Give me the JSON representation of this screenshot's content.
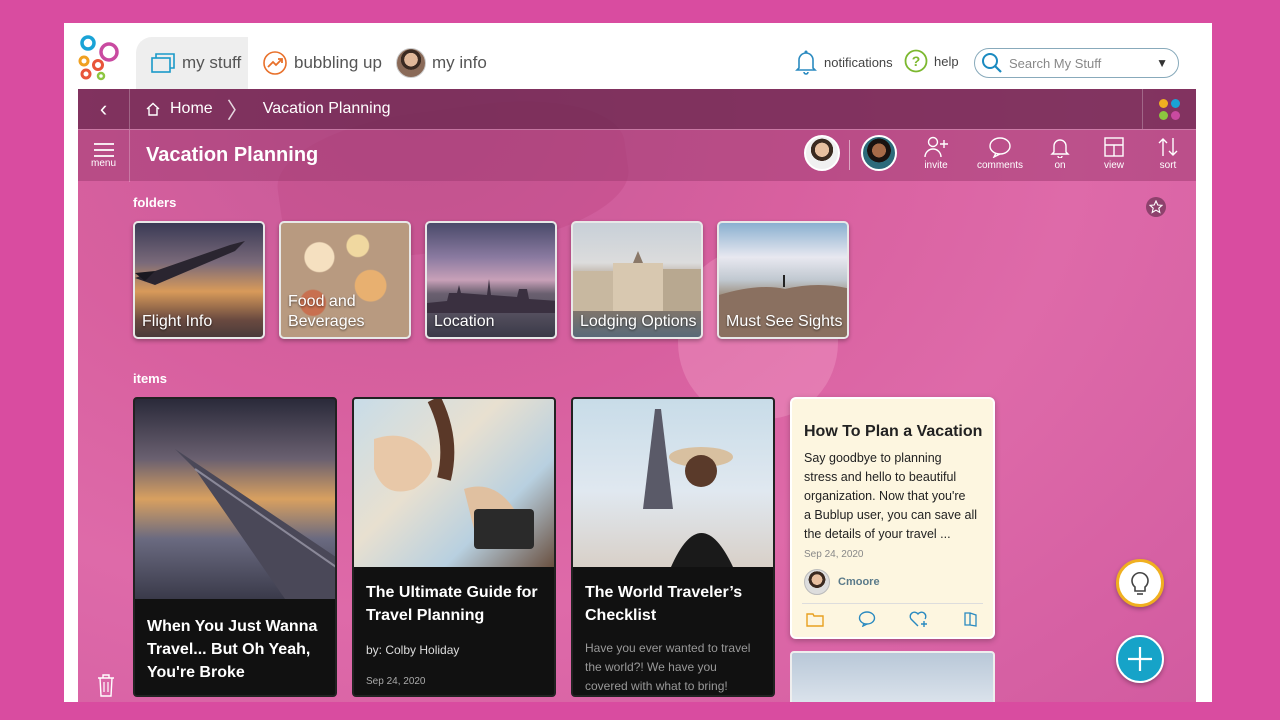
{
  "nav": {
    "tabs": [
      {
        "label": "my stuff"
      },
      {
        "label": "bubbling up"
      },
      {
        "label": "my info"
      }
    ],
    "notifications_label": "notifications",
    "help_label": "help",
    "search_placeholder": "Search My Stuff"
  },
  "breadcrumb": {
    "home": "Home",
    "current": "Vacation Planning"
  },
  "titlebar": {
    "menu_label": "menu",
    "title": "Vacation Planning",
    "tools": {
      "invite": "invite",
      "comments": "comments",
      "on": "on",
      "view": "view",
      "sort": "sort"
    }
  },
  "sections": {
    "folders_label": "folders",
    "items_label": "items"
  },
  "folders": [
    {
      "line1": "Flight Info",
      "line2": ""
    },
    {
      "line1": "Food and",
      "line2": "Beverages"
    },
    {
      "line1": "Location",
      "line2": ""
    },
    {
      "line1": "Lodging Options",
      "line2": ""
    },
    {
      "line1": "Must See Sights",
      "line2": ""
    }
  ],
  "items": [
    {
      "title_lines": [
        "When You Just Wanna",
        "Travel... But Oh Yeah,",
        "You're Broke"
      ]
    },
    {
      "title_lines": [
        "The Ultimate Guide for",
        "Travel Planning"
      ],
      "byline": "by: Colby Holiday",
      "date": "Sep 24, 2020"
    },
    {
      "title_lines": [
        "The World Traveler’s",
        "Checklist"
      ],
      "desc_lines": [
        "Have you ever wanted to travel",
        "the world?! We have you",
        "covered with what to bring!"
      ]
    }
  ],
  "note": {
    "title": "How To Plan a Vacation",
    "body_lines": [
      "Say goodbye to planning",
      "stress and hello to beautiful",
      "organization. Now that you're",
      "a Bublup user, you can save all",
      "the details of your travel ..."
    ],
    "date": "Sep 24, 2020",
    "author": "Cmoore"
  },
  "colors": {
    "background": "#d94ca0",
    "accent": "#16a3c8",
    "bulb_ring": "#f0b020"
  }
}
